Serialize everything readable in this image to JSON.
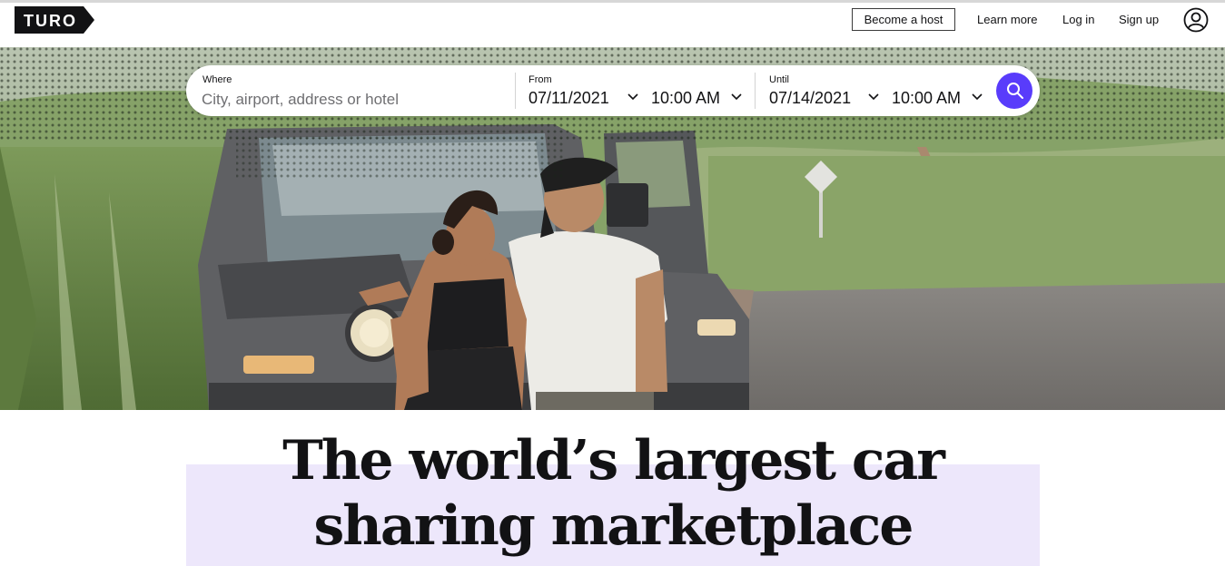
{
  "brand": {
    "logo_text": "TURO",
    "accent": "#593cfb",
    "highlight": "#ede7fb"
  },
  "nav": {
    "become_host": "Become a host",
    "learn_more": "Learn more",
    "log_in": "Log in",
    "sign_up": "Sign up",
    "user_icon": "user-circle-icon"
  },
  "search": {
    "where_label": "Where",
    "where_placeholder": "City, airport, address or hotel",
    "from_label": "From",
    "from_date": "07/11/2021",
    "from_time": "10:00 AM",
    "until_label": "Until",
    "until_date": "07/14/2021",
    "until_time": "10:00 AM",
    "search_icon": "search-icon"
  },
  "hero": {
    "headline_line1": "The world’s largest car",
    "headline_line2": "sharing marketplace"
  }
}
